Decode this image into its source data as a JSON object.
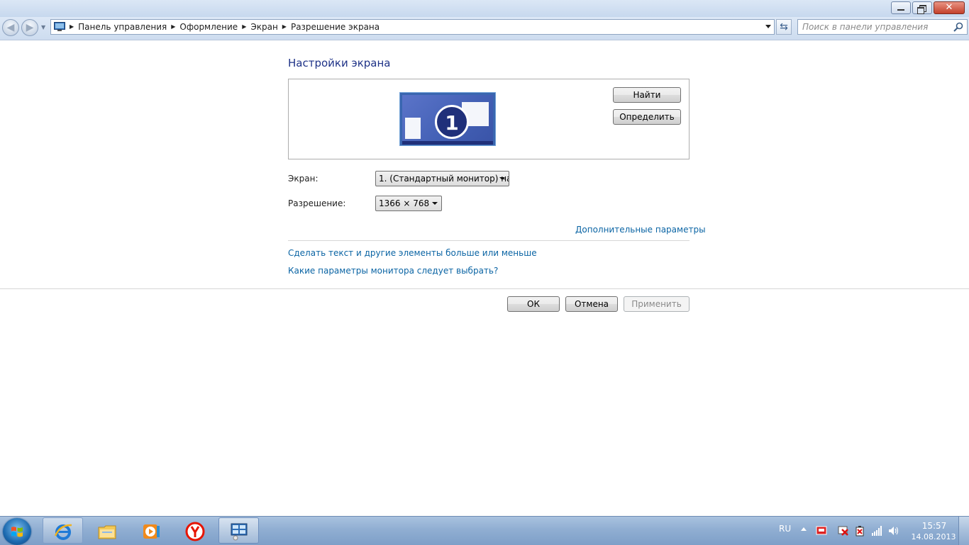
{
  "address_bar": {
    "breadcrumbs": [
      "Панель управления",
      "Оформление",
      "Экран",
      "Разрешение экрана"
    ],
    "search_placeholder": "Поиск в панели управления"
  },
  "main": {
    "title": "Настройки экрана",
    "monitor_number": "1",
    "find_button": "Найти",
    "identify_button": "Определить",
    "display_label": "Экран:",
    "display_value": "1. (Стандартный монитор) на",
    "resolution_label": "Разрешение:",
    "resolution_value": "1366 × 768",
    "advanced_link": "Дополнительные параметры",
    "text_size_link": "Сделать текст и другие элементы больше или меньше",
    "monitor_help_link": "Какие параметры монитора следует выбрать?"
  },
  "dialog_buttons": {
    "ok": "ОК",
    "cancel": "Отмена",
    "apply": "Применить"
  },
  "taskbar": {
    "pinned": [
      "internet-explorer-icon",
      "explorer-folder-icon",
      "media-player-icon",
      "yandex-browser-icon",
      "control-panel-icon"
    ],
    "tray": {
      "language": "RU",
      "time": "15:57",
      "date": "14.08.2013"
    }
  },
  "colors": {
    "title_blue": "#1e3287",
    "link_blue": "#0a64a4",
    "taskbar": "#90aed2"
  }
}
